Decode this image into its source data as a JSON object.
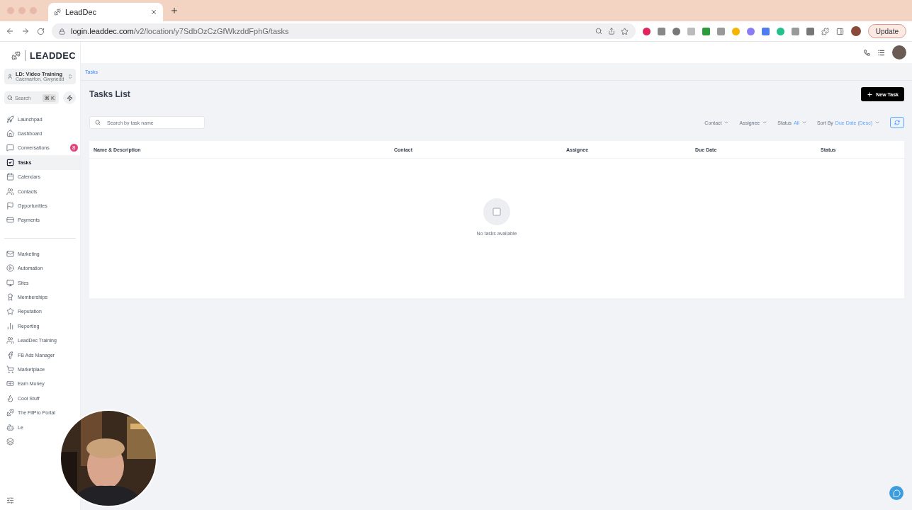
{
  "browser": {
    "tab_title": "LeadDec",
    "url_host": "login.leaddec.com",
    "url_path": "/v2/location/y7SdbOzCzGfWkzddFphG/tasks",
    "update_button": "Update"
  },
  "sidebar": {
    "logo": "LEADDEC",
    "account": {
      "name": "LD: Video Training",
      "location": "Caernarfon, Gwynedd"
    },
    "search": {
      "placeholder": "Search",
      "shortcut": "⌘ K"
    },
    "primary_items": [
      {
        "label": "Launchpad",
        "selected": false
      },
      {
        "label": "Dashboard",
        "selected": false
      },
      {
        "label": "Conversations",
        "selected": false,
        "badge": "8"
      },
      {
        "label": "Tasks",
        "selected": true
      },
      {
        "label": "Calendars",
        "selected": false
      },
      {
        "label": "Contacts",
        "selected": false
      },
      {
        "label": "Opportunities",
        "selected": false
      },
      {
        "label": "Payments",
        "selected": false
      }
    ],
    "secondary_items": [
      {
        "label": "Marketing",
        "selected": false
      },
      {
        "label": "Automation",
        "selected": false
      },
      {
        "label": "Sites",
        "selected": false
      },
      {
        "label": "Memberships",
        "selected": false
      },
      {
        "label": "Reputation",
        "selected": false
      },
      {
        "label": "Reporting",
        "selected": false
      },
      {
        "label": "LeadDec Training",
        "selected": false
      },
      {
        "label": "FB Ads Manager",
        "selected": false
      },
      {
        "label": "Marketplace",
        "selected": false
      },
      {
        "label": "Earn Money",
        "selected": false
      },
      {
        "label": "Cool Stuff",
        "selected": false
      },
      {
        "label": "The FitPro Portal",
        "selected": false
      },
      {
        "label": "Le",
        "selected": false
      },
      {
        "selected": false
      }
    ]
  },
  "breadcrumb": "Tasks",
  "page_title": "Tasks List",
  "new_task_button": "New Task",
  "task_search": {
    "placeholder": "Search by task name"
  },
  "filters": [
    {
      "label": "Contact"
    },
    {
      "label": "Assignee"
    },
    {
      "label": "Status",
      "value": "All"
    },
    {
      "label": "Sort By",
      "value": "Due Date (Desc)"
    }
  ],
  "table": {
    "columns": [
      "Name & Description",
      "Contact",
      "Assignee",
      "Due Date",
      "Status"
    ],
    "empty_text": "No tasks available"
  }
}
